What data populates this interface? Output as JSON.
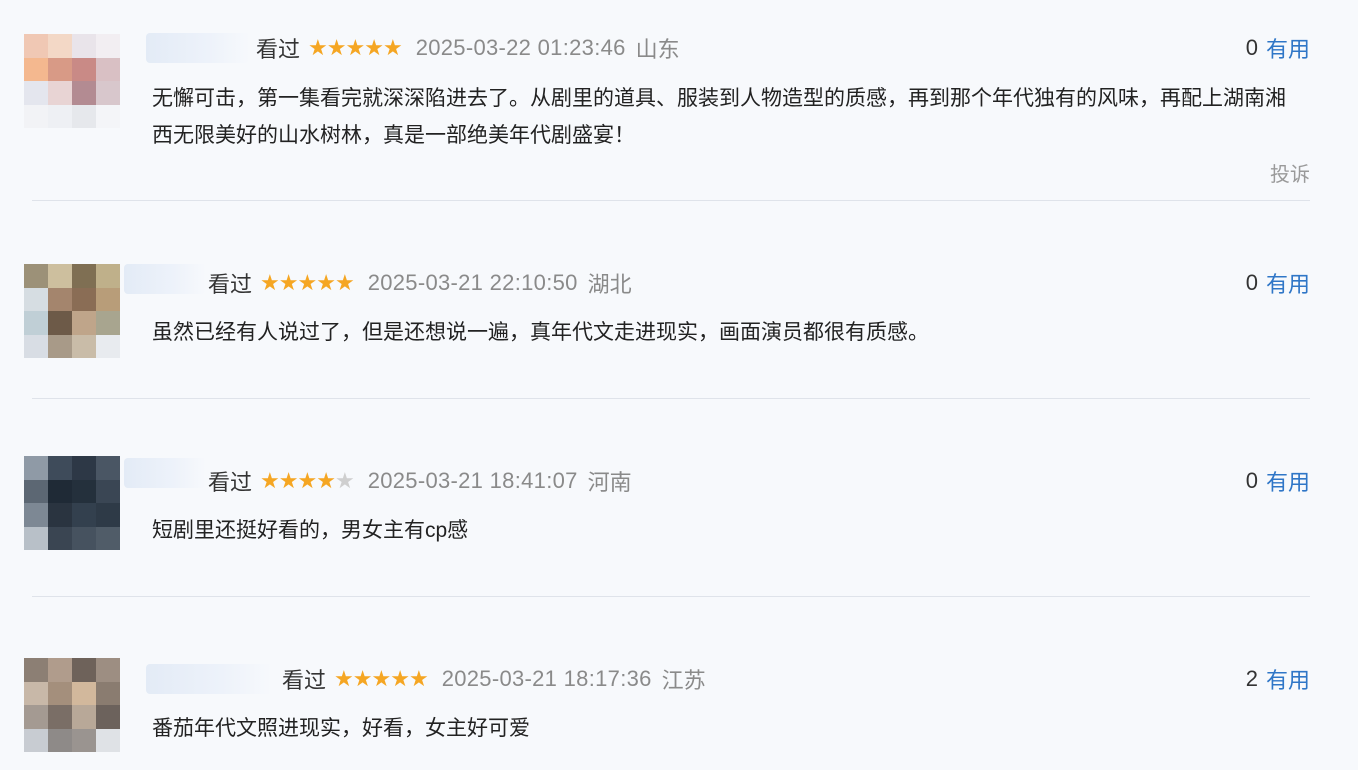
{
  "reviews": [
    {
      "status": "看过",
      "rating": 5,
      "time": "2025-03-22 01:23:46",
      "location": "山东",
      "helpful_count": "0",
      "helpful_label": "有用",
      "text": "无懈可击，第一集看完就深深陷进去了。从剧里的道具、服装到人物造型的质感，再到那个年代独有的风味，再配上湖南湘西无限美好的山水树林，真是一部绝美年代剧盛宴！",
      "report": "投诉",
      "avatar_colors": [
        "#f0c8b4",
        "#f3d8c6",
        "#e9e4ea",
        "#f2eef2",
        "#f4b88f",
        "#d89a86",
        "#c98a86",
        "#d9c0c4",
        "#e4e6ee",
        "#e8d4d4",
        "#b38b92",
        "#d8c7cc",
        "#f2f3f6",
        "#eef0f4",
        "#e6e8ec",
        "#f4f5f8"
      ]
    },
    {
      "status": "看过",
      "rating": 5,
      "time": "2025-03-21 22:10:50",
      "location": "湖北",
      "helpful_count": "0",
      "helpful_label": "有用",
      "text": "虽然已经有人说过了，但是还想说一遍，真年代文走进现实，画面演员都很有质感。",
      "avatar_colors": [
        "#9c9178",
        "#cdbf9e",
        "#7f6f53",
        "#bfb08a",
        "#d6dde2",
        "#a4856d",
        "#8a6d55",
        "#b89d79",
        "#c0cfd6",
        "#6d5a48",
        "#bfa58a",
        "#a8a58f",
        "#d8dde4",
        "#a89a88",
        "#c9bca8",
        "#e8ebef"
      ]
    },
    {
      "status": "看过",
      "rating": 4,
      "time": "2025-03-21 18:41:07",
      "location": "河南",
      "helpful_count": "0",
      "helpful_label": "有用",
      "text": "短剧里还挺好看的，男女主有cp感",
      "avatar_colors": [
        "#8f9aa6",
        "#3e4b5a",
        "#2d3846",
        "#4a5664",
        "#5c6773",
        "#1f2a36",
        "#24303c",
        "#3a4654",
        "#7d8894",
        "#2a3440",
        "#33404e",
        "#2e3a47",
        "#b8c0c8",
        "#3a4552",
        "#46525f",
        "#505c68"
      ]
    },
    {
      "status": "看过",
      "rating": 5,
      "time": "2025-03-21 18:17:36",
      "location": "江苏",
      "helpful_count": "2",
      "helpful_label": "有用",
      "text": "番茄年代文照进现实，好看，女主好可爱",
      "avatar_colors": [
        "#8c7f74",
        "#b09c8c",
        "#6e625a",
        "#9d8e82",
        "#c8b8a8",
        "#a48f7c",
        "#d2b89c",
        "#8a7c70",
        "#a49a92",
        "#7a6e66",
        "#b8a898",
        "#6c625c",
        "#c8ccd2",
        "#8e8a88",
        "#9a9490",
        "#dfe2e6"
      ]
    }
  ]
}
